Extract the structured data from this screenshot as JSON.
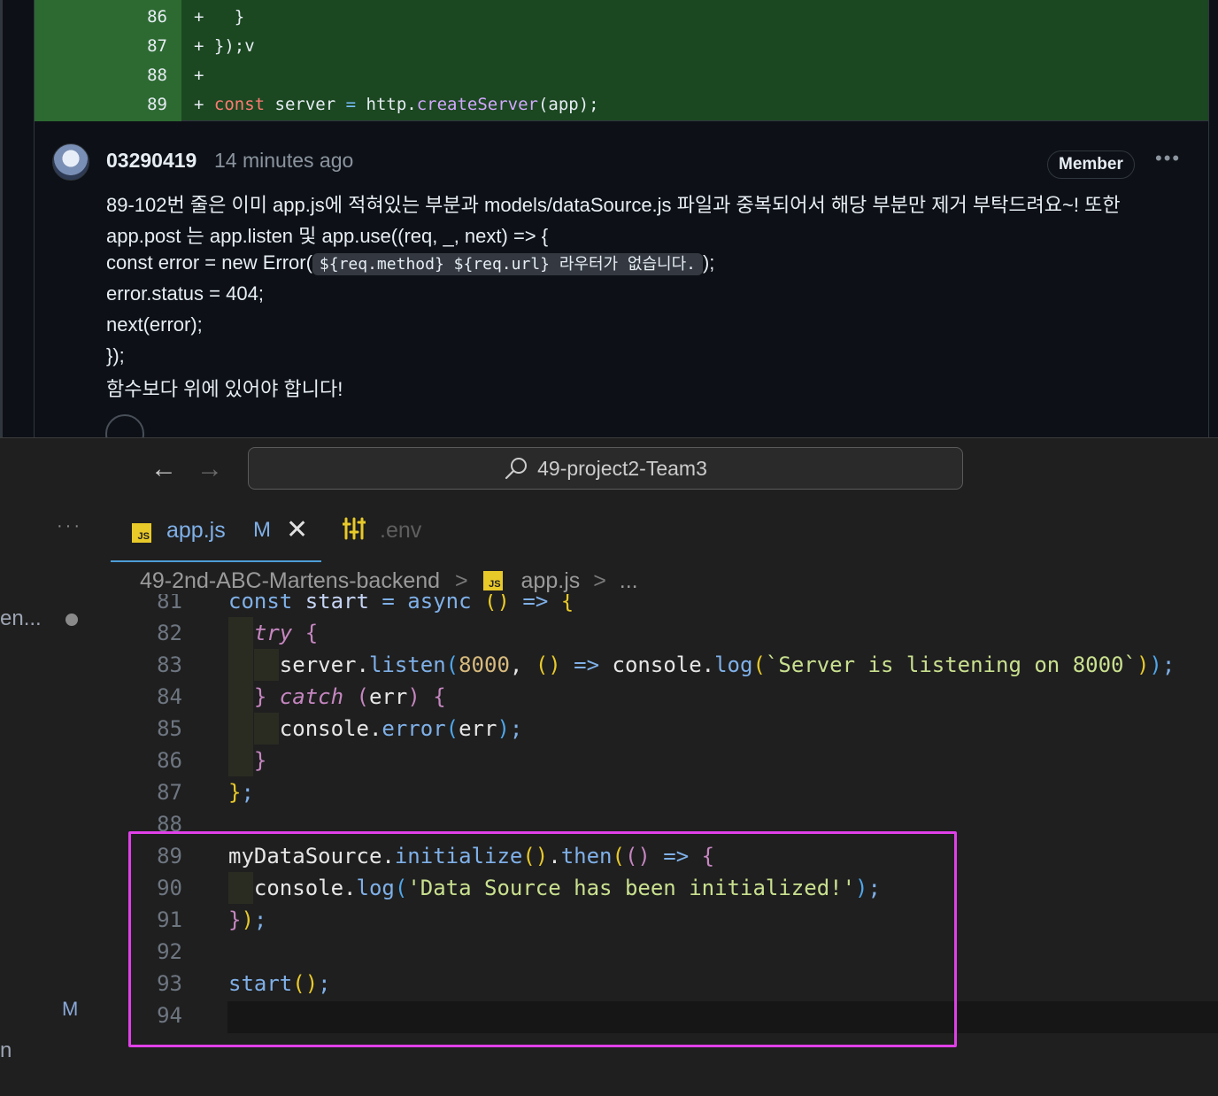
{
  "github": {
    "diff_lines": [
      {
        "num": "86",
        "segments": [
          {
            "t": "+   }",
            "c": ""
          }
        ]
      },
      {
        "num": "87",
        "segments": [
          {
            "t": "+ });v",
            "c": ""
          }
        ]
      },
      {
        "num": "88",
        "segments": [
          {
            "t": "+",
            "c": ""
          }
        ]
      },
      {
        "num": "89",
        "segments": [
          {
            "t": "+ ",
            "c": ""
          },
          {
            "t": "const",
            "c": "tok-kw"
          },
          {
            "t": " server ",
            "c": ""
          },
          {
            "t": "=",
            "c": "tok-op"
          },
          {
            "t": " http.",
            "c": ""
          },
          {
            "t": "createServer",
            "c": "tok-fn"
          },
          {
            "t": "(app);",
            "c": ""
          }
        ]
      }
    ],
    "comment": {
      "author": "03290419",
      "time": "14 minutes ago",
      "role_badge": "Member",
      "more_label": "•••",
      "line1": "89-102번 줄은 이미 app.js에 적혀있는 부분과 models/dataSource.js 파일과 중복되어서 해당 부분만 제거 부탁드려요~! 또한",
      "line2": "app.post 는 app.listen 및 app.use((req, _, next) => {",
      "line3_prefix": "const error = new Error(",
      "line3_code": "${req.method} ${req.url} 라우터가 없습니다.",
      "line3_suffix": ");",
      "line4": "error.status = 404;",
      "line5": "next(error);",
      "line6": "});",
      "line7": "함수보다 위에 있어야 합니다!"
    }
  },
  "vscode": {
    "nav": {
      "back": "←",
      "forward": "→"
    },
    "command_center": {
      "icon": "search-icon",
      "text": "49-project2-Team3"
    },
    "sidebar": {
      "dots": "···",
      "item_label": "en...",
      "modified": "M",
      "item2_label": "n"
    },
    "tabs": [
      {
        "label": "app.js",
        "badge": "JS",
        "status": "M",
        "close": "✕",
        "active": true
      },
      {
        "label": ".env",
        "icon": "settings-sliders-icon",
        "active": false
      }
    ],
    "breadcrumb": {
      "folder": "49-2nd-ABC-Martens-backend",
      "sep": ">",
      "badge": "JS",
      "file": "app.js",
      "tail": "..."
    },
    "accent_colors": {
      "highlight_box": "#e040e8",
      "tab_underline": "#4d9dd6",
      "js_badge": "#e8c92a"
    },
    "code_lines": [
      {
        "num": "81",
        "segs": [
          {
            "t": "const",
            "c": "c-def"
          },
          {
            "t": " start ",
            "c": "c-var"
          },
          {
            "t": "=",
            "c": "c-def"
          },
          {
            "t": " async ",
            "c": "c-def"
          },
          {
            "t": "()",
            "c": "c-br1"
          },
          {
            "t": " => ",
            "c": "c-def"
          },
          {
            "t": "{",
            "c": "c-br1"
          }
        ]
      },
      {
        "num": "82",
        "segs": [
          {
            "t": "  ",
            "c": ""
          },
          {
            "t": "try",
            "c": "c-it"
          },
          {
            "t": " {",
            "c": "c-br2"
          }
        ]
      },
      {
        "num": "83",
        "segs": [
          {
            "t": "    server.",
            "c": "c-plain"
          },
          {
            "t": "listen",
            "c": "c-fn"
          },
          {
            "t": "(",
            "c": "c-br3"
          },
          {
            "t": "8000",
            "c": "c-num"
          },
          {
            "t": ", ",
            "c": "c-plain"
          },
          {
            "t": "()",
            "c": "c-br1"
          },
          {
            "t": " => ",
            "c": "c-def"
          },
          {
            "t": "console.",
            "c": "c-plain"
          },
          {
            "t": "log",
            "c": "c-fn"
          },
          {
            "t": "(",
            "c": "c-br1"
          },
          {
            "t": "`Server is listening on 8000`",
            "c": "c-str"
          },
          {
            "t": ")",
            "c": "c-br1"
          },
          {
            "t": ")",
            "c": "c-br3"
          },
          {
            "t": ";",
            "c": "c-fn"
          }
        ]
      },
      {
        "num": "84",
        "segs": [
          {
            "t": "  ",
            "c": ""
          },
          {
            "t": "}",
            "c": "c-br2"
          },
          {
            "t": " catch ",
            "c": "c-it"
          },
          {
            "t": "(",
            "c": "c-br2"
          },
          {
            "t": "err",
            "c": "c-plain"
          },
          {
            "t": ")",
            "c": "c-br2"
          },
          {
            "t": " {",
            "c": "c-br2"
          }
        ]
      },
      {
        "num": "85",
        "segs": [
          {
            "t": "    console.",
            "c": "c-plain"
          },
          {
            "t": "error",
            "c": "c-fn"
          },
          {
            "t": "(",
            "c": "c-br3"
          },
          {
            "t": "err",
            "c": "c-plain"
          },
          {
            "t": ")",
            "c": "c-br3"
          },
          {
            "t": ";",
            "c": "c-fn"
          }
        ]
      },
      {
        "num": "86",
        "segs": [
          {
            "t": "  ",
            "c": ""
          },
          {
            "t": "}",
            "c": "c-br2"
          }
        ]
      },
      {
        "num": "87",
        "segs": [
          {
            "t": "}",
            "c": "c-br1"
          },
          {
            "t": ";",
            "c": "c-fn"
          }
        ]
      },
      {
        "num": "88",
        "segs": []
      },
      {
        "num": "89",
        "segs": [
          {
            "t": "myDataSource.",
            "c": "c-plain"
          },
          {
            "t": "initialize",
            "c": "c-fn"
          },
          {
            "t": "()",
            "c": "c-br1"
          },
          {
            "t": ".",
            "c": "c-plain"
          },
          {
            "t": "then",
            "c": "c-fn"
          },
          {
            "t": "(",
            "c": "c-br1"
          },
          {
            "t": "()",
            "c": "c-br2"
          },
          {
            "t": " => ",
            "c": "c-def"
          },
          {
            "t": "{",
            "c": "c-br2"
          }
        ]
      },
      {
        "num": "90",
        "segs": [
          {
            "t": "  console.",
            "c": "c-plain"
          },
          {
            "t": "log",
            "c": "c-fn"
          },
          {
            "t": "(",
            "c": "c-br3"
          },
          {
            "t": "'Data Source has been initialized!'",
            "c": "c-str"
          },
          {
            "t": ")",
            "c": "c-br3"
          },
          {
            "t": ";",
            "c": "c-fn"
          }
        ]
      },
      {
        "num": "91",
        "segs": [
          {
            "t": "}",
            "c": "c-br2"
          },
          {
            "t": ")",
            "c": "c-br1"
          },
          {
            "t": ";",
            "c": "c-fn"
          }
        ]
      },
      {
        "num": "92",
        "segs": []
      },
      {
        "num": "93",
        "segs": [
          {
            "t": "start",
            "c": "c-fn"
          },
          {
            "t": "()",
            "c": "c-br1"
          },
          {
            "t": ";",
            "c": "c-fn"
          }
        ]
      },
      {
        "num": "94",
        "segs": []
      }
    ]
  }
}
